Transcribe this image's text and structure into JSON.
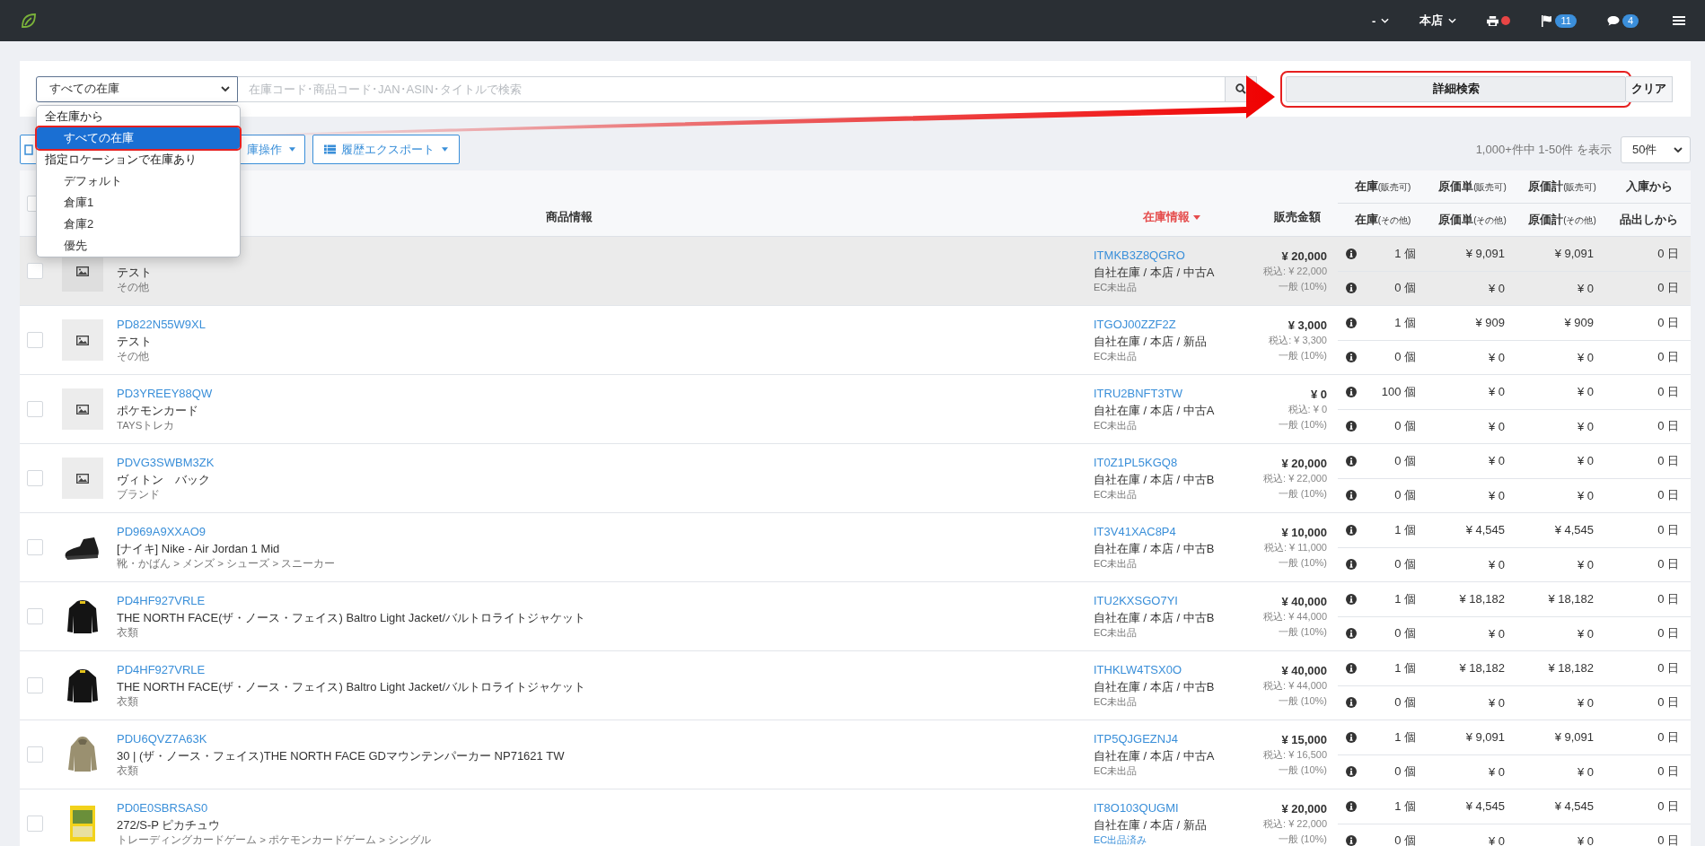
{
  "topbar": {
    "items": [
      {
        "kind": "dropdown",
        "label": "-"
      },
      {
        "kind": "dropdown",
        "label": "本店"
      },
      {
        "kind": "printer",
        "alert": true
      },
      {
        "kind": "flag",
        "badge": "11"
      },
      {
        "kind": "comment",
        "badge": "4"
      },
      {
        "kind": "menu"
      }
    ]
  },
  "search": {
    "scope": "すべての在庫",
    "placeholder": "在庫コード･商品コード･JAN･ASIN･タイトルで検索",
    "advanced": {
      "label": "詳細検索",
      "annotated": true
    },
    "clear": "クリア"
  },
  "scope_dropdown": {
    "groups": [
      {
        "label": "全在庫から",
        "options": [
          {
            "label": "すべての在庫",
            "selected": true,
            "annotated": true
          }
        ]
      },
      {
        "label": "指定ロケーションで在庫あり",
        "options": [
          {
            "label": "デフォルト",
            "selected": false,
            "annotated": false
          },
          {
            "label": "倉庫1",
            "selected": false,
            "annotated": false
          },
          {
            "label": "倉庫2",
            "selected": false,
            "annotated": false
          },
          {
            "label": "優先",
            "selected": false,
            "annotated": false
          }
        ]
      }
    ]
  },
  "annotation": {
    "arrow": true
  },
  "toolbar": {
    "buttons": [
      {
        "kind": "hidden"
      },
      {
        "kind": "caret",
        "label": "庫操作"
      },
      {
        "kind": "list",
        "label": "履歴エクスポート"
      }
    ],
    "paging": "1,000+件中 1-50件 を表示",
    "per_page": "50件"
  },
  "table": {
    "header": {
      "checked": false,
      "product": "商品情報",
      "stock_info": {
        "label": "在庫情報",
        "sorted": true
      },
      "price": "販売金額",
      "columns": [
        {
          "top": "在庫",
          "top_note": "(販売可)",
          "bottom": "在庫",
          "bottom_note": "(その他)"
        },
        {
          "top": "原価単",
          "top_note": "(販売可)",
          "bottom": "原価単",
          "bottom_note": "(その他)"
        },
        {
          "top": "原価計",
          "top_note": "(販売可)",
          "bottom": "原価計",
          "bottom_note": "(その他)"
        },
        {
          "top": "入庫から",
          "bottom": "品出しから"
        }
      ]
    },
    "rows": [
      {
        "checked": false,
        "highlighted": true,
        "kind": "placeholder",
        "name": "テスト",
        "category": "その他",
        "stock_code": "ITMKB3Z8QGRO",
        "location": "自社在庫 / 本店 / 中古A",
        "ec": "EC未出品",
        "ec_listed": false,
        "price": "¥ 20,000",
        "tax_included": "税込: ¥ 22,000",
        "tax_class": "一般 (10%)",
        "sellable": [
          "1 個",
          "¥ 9,091",
          "¥ 9,091",
          "0 日"
        ],
        "other": [
          "0 個",
          "¥ 0",
          "¥ 0",
          "0 日"
        ]
      },
      {
        "checked": false,
        "highlighted": false,
        "kind": "placeholder",
        "code": "PD822N55W9XL",
        "name": "テスト",
        "category": "その他",
        "stock_code": "ITGOJ00ZZF2Z",
        "location": "自社在庫 / 本店 / 新品",
        "ec": "EC未出品",
        "ec_listed": false,
        "price": "¥ 3,000",
        "tax_included": "税込: ¥ 3,300",
        "tax_class": "一般 (10%)",
        "sellable": [
          "1 個",
          "¥ 909",
          "¥ 909",
          "0 日"
        ],
        "other": [
          "0 個",
          "¥ 0",
          "¥ 0",
          "0 日"
        ]
      },
      {
        "checked": false,
        "highlighted": false,
        "kind": "placeholder",
        "code": "PD3YREEY88QW",
        "name": "ポケモンカード",
        "category": "TAYSトレカ",
        "stock_code": "ITRU2BNFT3TW",
        "location": "自社在庫 / 本店 / 中古A",
        "ec": "EC未出品",
        "ec_listed": false,
        "price": "¥ 0",
        "tax_included": "税込: ¥ 0",
        "tax_class": "一般 (10%)",
        "sellable": [
          "100 個",
          "¥ 0",
          "¥ 0",
          "0 日"
        ],
        "other": [
          "0 個",
          "¥ 0",
          "¥ 0",
          "0 日"
        ]
      },
      {
        "checked": false,
        "highlighted": false,
        "kind": "placeholder",
        "code": "PDVG3SWBM3ZK",
        "name": "ヴィトン　バック",
        "category": "ブランド",
        "stock_code": "IT0Z1PL5KGQ8",
        "location": "自社在庫 / 本店 / 中古B",
        "ec": "EC未出品",
        "ec_listed": false,
        "price": "¥ 20,000",
        "tax_included": "税込: ¥ 22,000",
        "tax_class": "一般 (10%)",
        "sellable": [
          "0 個",
          "¥ 0",
          "¥ 0",
          "0 日"
        ],
        "other": [
          "0 個",
          "¥ 0",
          "¥ 0",
          "0 日"
        ]
      },
      {
        "checked": false,
        "highlighted": false,
        "kind": "picture",
        "code": "PD969A9XXAO9",
        "name": "[ナイキ] Nike - Air Jordan 1 Mid",
        "category": "靴・かばん > メンズ > シューズ > スニーカー",
        "stock_code": "IT3V41XAC8P4",
        "location": "自社在庫 / 本店 / 中古B",
        "ec": "EC未出品",
        "ec_listed": false,
        "price": "¥ 10,000",
        "tax_included": "税込: ¥ 11,000",
        "tax_class": "一般 (10%)",
        "sellable": [
          "1 個",
          "¥ 4,545",
          "¥ 4,545",
          "0 日"
        ],
        "other": [
          "0 個",
          "¥ 0",
          "¥ 0",
          "0 日"
        ]
      },
      {
        "checked": false,
        "highlighted": false,
        "kind": "picture",
        "code": "PD4HF927VRLE",
        "name": "THE NORTH FACE(ザ・ノース・フェイス) Baltro Light Jacket/バルトロライトジャケット",
        "category": "衣類",
        "stock_code": "ITU2KXSGO7YI",
        "location": "自社在庫 / 本店 / 中古B",
        "ec": "EC未出品",
        "ec_listed": false,
        "price": "¥ 40,000",
        "tax_included": "税込: ¥ 44,000",
        "tax_class": "一般 (10%)",
        "sellable": [
          "1 個",
          "¥ 18,182",
          "¥ 18,182",
          "0 日"
        ],
        "other": [
          "0 個",
          "¥ 0",
          "¥ 0",
          "0 日"
        ]
      },
      {
        "checked": false,
        "highlighted": false,
        "kind": "picture",
        "code": "PD4HF927VRLE",
        "name": "THE NORTH FACE(ザ・ノース・フェイス) Baltro Light Jacket/バルトロライトジャケット",
        "category": "衣類",
        "stock_code": "ITHKLW4TSX0O",
        "location": "自社在庫 / 本店 / 中古B",
        "ec": "EC未出品",
        "ec_listed": false,
        "price": "¥ 40,000",
        "tax_included": "税込: ¥ 44,000",
        "tax_class": "一般 (10%)",
        "sellable": [
          "1 個",
          "¥ 18,182",
          "¥ 18,182",
          "0 日"
        ],
        "other": [
          "0 個",
          "¥ 0",
          "¥ 0",
          "0 日"
        ]
      },
      {
        "checked": false,
        "highlighted": false,
        "kind": "picture",
        "code": "PDU6QVZ7A63K",
        "name": "30 | (ザ・ノース・フェイス)THE NORTH FACE GDマウンテンパーカー NP71621 TW",
        "category": "衣類",
        "stock_code": "ITP5QJGEZNJ4",
        "location": "自社在庫 / 本店 / 中古A",
        "ec": "EC未出品",
        "ec_listed": false,
        "price": "¥ 15,000",
        "tax_included": "税込: ¥ 16,500",
        "tax_class": "一般 (10%)",
        "sellable": [
          "1 個",
          "¥ 9,091",
          "¥ 9,091",
          "0 日"
        ],
        "other": [
          "0 個",
          "¥ 0",
          "¥ 0",
          "0 日"
        ]
      },
      {
        "checked": false,
        "highlighted": false,
        "kind": "picture",
        "code": "PD0E0SBRSAS0",
        "name": "272/S-P ピカチュウ",
        "category": "トレーディングカードゲーム > ポケモンカードゲーム > シングル",
        "stock_code": "IT8O103QUGMI",
        "location": "自社在庫 / 本店 / 新品",
        "ec": "EC出品済み",
        "ec_listed": true,
        "price": "¥ 20,000",
        "tax_included": "税込: ¥ 22,000",
        "tax_class": "一般 (10%)",
        "sellable": [
          "1 個",
          "¥ 4,545",
          "¥ 4,545",
          "0 日"
        ],
        "other": [
          "0 個",
          "¥ 0",
          "¥ 0",
          "0 日"
        ]
      }
    ]
  }
}
